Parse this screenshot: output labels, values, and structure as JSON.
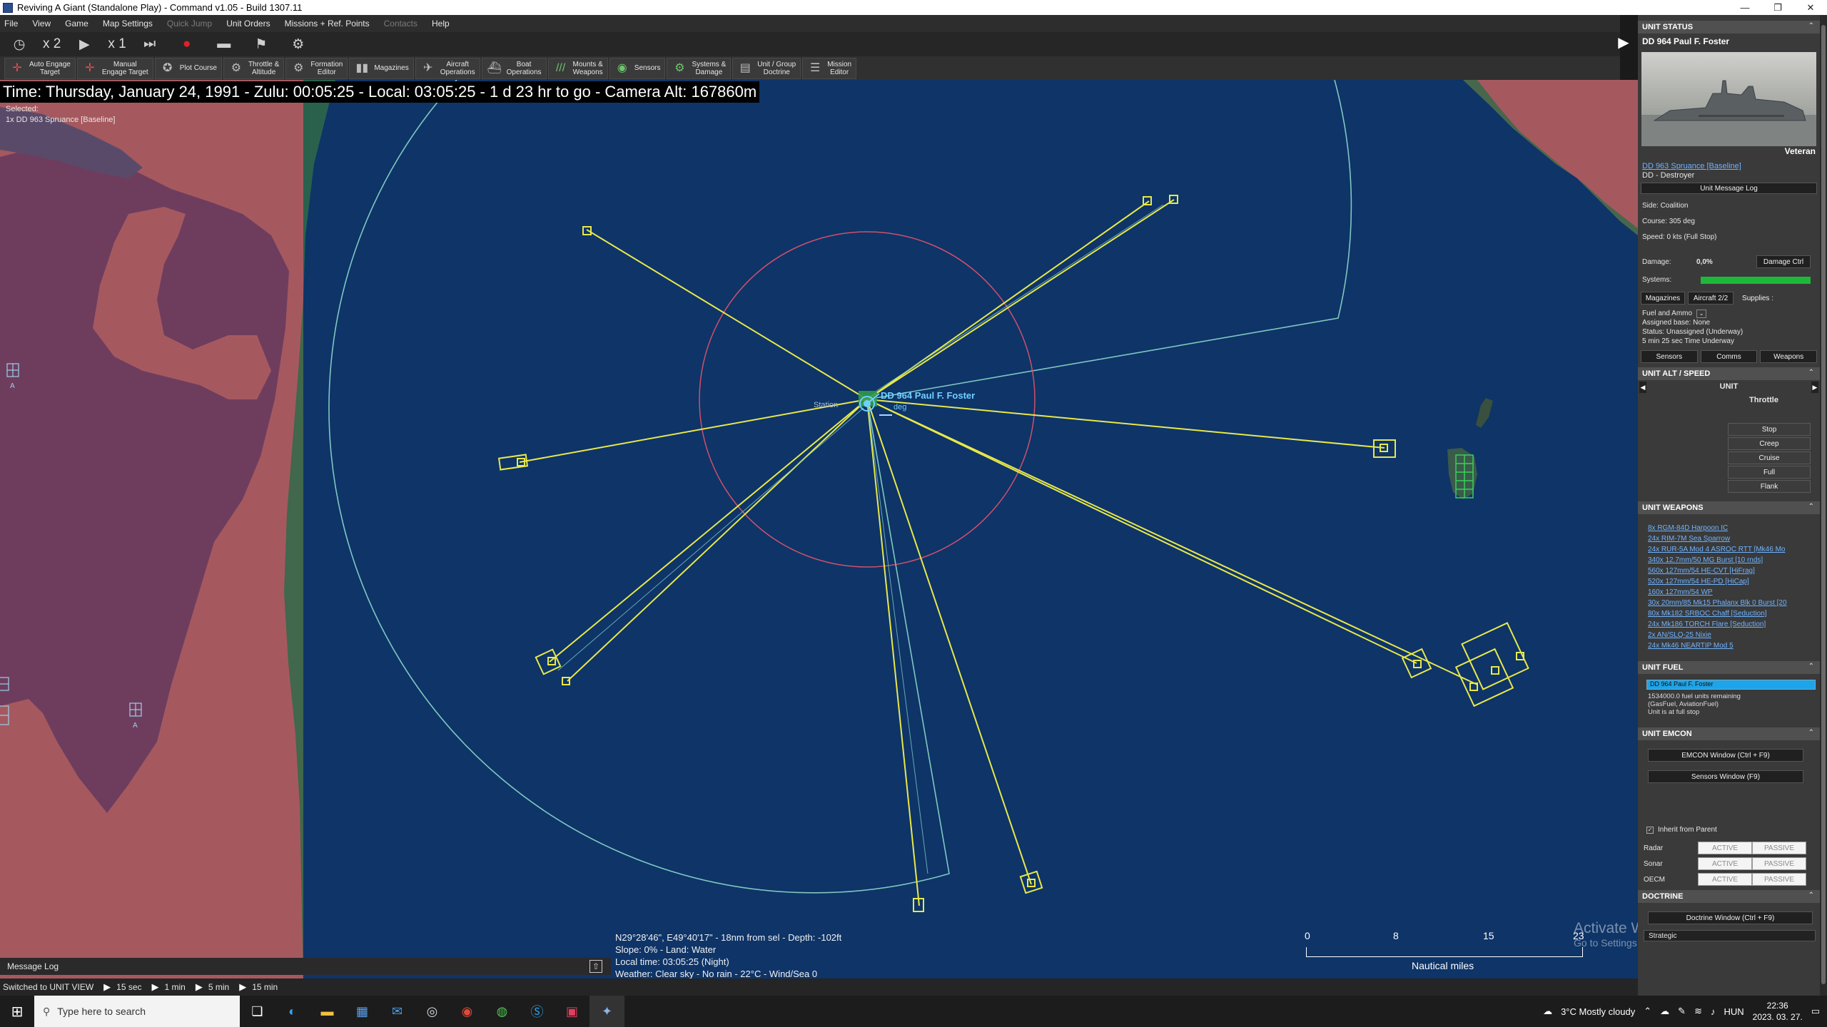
{
  "window": {
    "title": "Reviving A Giant (Standalone Play) - Command v1.05 - Build 1307.11",
    "controls": [
      "—",
      "❐",
      "✕"
    ]
  },
  "menu": {
    "items": [
      "File",
      "View",
      "Game",
      "Map Settings",
      "Quick Jump",
      "Unit Orders",
      "Missions + Ref. Points",
      "Contacts",
      "Help"
    ]
  },
  "sim_controls": {
    "speed_multiplier": "x 2",
    "step_multiplier": "x 1"
  },
  "toolbar": {
    "buttons": [
      {
        "label": "Auto Engage\nTarget"
      },
      {
        "label": "Manual\nEngage Target"
      },
      {
        "label": "Plot Course"
      },
      {
        "label": "Throttle &\nAltitude"
      },
      {
        "label": "Formation\nEditor"
      },
      {
        "label": "Magazines"
      },
      {
        "label": "Aircraft\nOperations"
      },
      {
        "label": "Boat\nOperations"
      },
      {
        "label": "Mounts &\nWeapons"
      },
      {
        "label": "Sensors"
      },
      {
        "label": "Systems &\nDamage"
      },
      {
        "label": "Unit / Group\nDoctrine"
      },
      {
        "label": "Mission\nEditor"
      }
    ]
  },
  "map": {
    "time_banner": "Time: Thursday, January 24, 1991 - Zulu: 00:05:25 - Local: 03:05:25 - 1 d 23 hr to go -  Camera Alt: 167860m",
    "selected_label": "Selected:",
    "selected_unit": "1x DD 963 Spruance [Baseline]",
    "unit_label": "DD 964 Paul F. Foster",
    "unit_sublabel": "deg",
    "station_label": "Station",
    "cursor_info": [
      "N29°28'46\", E49°40'17\" - 18nm from sel - Depth: -102ft",
      "Slope: 0%  - Land: Water",
      "Local time: 03:05:25 (Night)",
      "Weather: Clear sky - No rain - 22°C - Wind/Sea 0"
    ],
    "scale_ticks": [
      "0",
      "8",
      "15",
      "23"
    ],
    "scale_unit": "Nautical miles",
    "watermark_line1": "Activate Windows",
    "watermark_line2": "Go to Settings to activate Windows.",
    "airbase_marker": "A"
  },
  "message_log": {
    "label": "Message Log"
  },
  "status_bar": {
    "message": "Switched to UNIT VIEW",
    "time_jumps": [
      "15 sec",
      "1 min",
      "5 min",
      "15 min"
    ]
  },
  "sidebar": {
    "unit_status": {
      "header": "UNIT STATUS",
      "unit_name": "DD 964 Paul F. Foster",
      "proficiency": "Veteran",
      "class_link": "DD 963 Spruance [Baseline]",
      "type": "DD - Destroyer",
      "message_log_btn": "Unit Message Log",
      "side": "Side: Coalition",
      "course": "Course: 305 deg",
      "speed": "Speed: 0 kts (Full Stop)",
      "damage_label": "Damage:",
      "damage_value": "0,0%",
      "damage_ctrl_btn": "Damage Ctrl",
      "systems_label": "Systems:",
      "systems_level": 1.0,
      "magazines_btn": "Magazines",
      "aircraft_btn": "Aircraft 2/2",
      "supplies_btn": "Supplies :",
      "fuel_ammo": "Fuel and Ammo",
      "assigned_base": "Assigned base: None",
      "status": "Status: Unassigned (Underway)",
      "time_underway": "5 min 25 sec Time Underway",
      "sensors_btn": "Sensors",
      "comms_btn": "Comms",
      "weapons_btn": "Weapons"
    },
    "alt_speed": {
      "header": "UNIT ALT / SPEED",
      "unit_label": "UNIT",
      "throttle_label": "Throttle",
      "throttle_buttons": [
        "Stop",
        "Creep",
        "Cruise",
        "Full",
        "Flank"
      ]
    },
    "weapons": {
      "header": "UNIT WEAPONS",
      "items": [
        "8x RGM-84D Harpoon IC",
        "24x RIM-7M Sea Sparrow",
        "24x RUR-5A Mod 4 ASROC RTT [Mk46 Mo",
        "340x 12.7mm/50 MG Burst [10 rnds]",
        "560x 127mm/54 HE-CVT [HiFrag]",
        "520x 127mm/54 HE-PD [HiCap]",
        "160x 127mm/54 WP",
        "30x 20mm/85 Mk15 Phalanx Blk 0 Burst [20",
        "80x Mk182 SRBOC Chaff [Seduction]",
        "24x Mk186 TORCH Flare [Seduction]",
        "2x AN/SLQ-25 Nixie",
        "24x Mk46 NEARTIP Mod 5"
      ]
    },
    "fuel": {
      "header": "UNIT FUEL",
      "bar_label": "DD 964 Paul F. Foster",
      "fuel_level": 1.0,
      "remaining": "1534000.0 fuel units remaining",
      "types": "(GasFuel, AviationFuel)",
      "state": "Unit is at full stop"
    },
    "emcon": {
      "header": "UNIT EMCON",
      "emcon_window_btn": "EMCON Window (Ctrl + F9)",
      "sensors_window_btn": "Sensors Window (F9)",
      "inherit": "Inherit from Parent",
      "rows": [
        {
          "label": "Radar",
          "active": "ACTIVE",
          "passive": "PASSIVE"
        },
        {
          "label": "Sonar",
          "active": "ACTIVE",
          "passive": "PASSIVE"
        },
        {
          "label": "OECM",
          "active": "ACTIVE",
          "passive": "PASSIVE"
        }
      ]
    },
    "doctrine": {
      "header": "DOCTRINE",
      "window_btn": "Doctrine Window (Ctrl + F9)",
      "strategic": "Strategic"
    }
  },
  "taskbar": {
    "search_placeholder": "Type here to search",
    "weather": "3°C  Mostly cloudy",
    "language": "HUN",
    "time": "22:36",
    "date": "2023. 03. 27."
  },
  "colors": {
    "sea": "#0e3468",
    "land": "#a5595f",
    "range_ring_cyan": "#7fc8c0",
    "range_ring_red": "#d0506a",
    "sensor_lines": "#e8e84a",
    "unit_label": "#6fd0ff",
    "link": "#6fb3ff",
    "record": "#e0212a"
  }
}
